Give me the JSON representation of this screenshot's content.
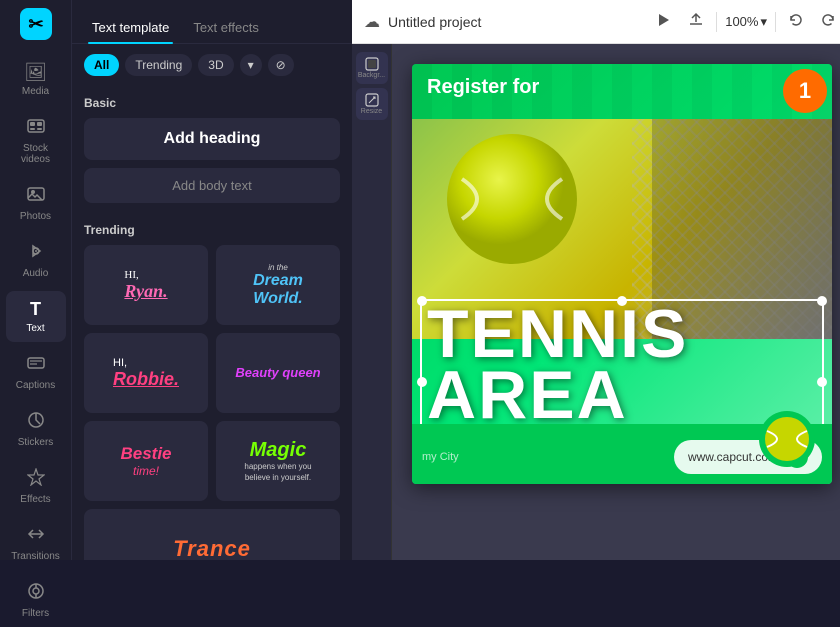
{
  "sidebar": {
    "logo": "✂",
    "items": [
      {
        "id": "media",
        "icon": "🖼",
        "label": "Media"
      },
      {
        "id": "stock-videos",
        "icon": "⊞",
        "label": "Stock videos"
      },
      {
        "id": "photos",
        "icon": "📷",
        "label": "Photos"
      },
      {
        "id": "audio",
        "icon": "♪",
        "label": "Audio"
      },
      {
        "id": "text",
        "icon": "T",
        "label": "Text",
        "active": true
      },
      {
        "id": "captions",
        "icon": "☰",
        "label": "Captions"
      },
      {
        "id": "stickers",
        "icon": "⊙",
        "label": "Stickers"
      },
      {
        "id": "effects",
        "icon": "✦",
        "label": "Effects"
      },
      {
        "id": "transitions",
        "icon": "⇄",
        "label": "Transitions"
      },
      {
        "id": "filters",
        "icon": "⊗",
        "label": "Filters"
      }
    ]
  },
  "panel": {
    "tab_template": "Text template",
    "tab_effects": "Text effects",
    "filters": {
      "all": "All",
      "trending": "Trending",
      "three_d": "3D",
      "dropdown": "▾",
      "filter_icon": "⊘"
    },
    "basic": {
      "title": "Basic",
      "add_heading": "Add heading",
      "add_body": "Add body text"
    },
    "trending": {
      "title": "Trending",
      "cards": [
        {
          "id": "hi-ryan",
          "type": "hi-ryan",
          "hi": "HI,",
          "name": "Ryan."
        },
        {
          "id": "dream-world",
          "type": "dream",
          "line1": "in the",
          "line2": "Dream",
          "line3": "World."
        },
        {
          "id": "hi-robbie",
          "type": "hi-robbie",
          "hi": "HI,",
          "name": "Robbie."
        },
        {
          "id": "beauty-queen",
          "type": "beauty",
          "text": "Beauty queen"
        },
        {
          "id": "bestie-time",
          "type": "bestie",
          "main": "Bestie",
          "sub": "time!"
        },
        {
          "id": "magic",
          "type": "magic",
          "main": "Magic",
          "sub": "happens when you\nbelieve in yourself."
        },
        {
          "id": "trance",
          "type": "trance",
          "text": "Trance"
        }
      ]
    }
  },
  "topbar": {
    "save_icon": "☁",
    "project_name": "Untitled project",
    "play_icon": "▶",
    "export_icon": "⬆",
    "zoom": "100%",
    "zoom_chevron": "▾",
    "undo_icon": "↩",
    "redo_icon": "↪"
  },
  "side_tools": [
    {
      "id": "background",
      "icon": "▭",
      "label": "Backgr..."
    },
    {
      "id": "resize",
      "icon": "⊡",
      "label": "Resize"
    }
  ],
  "canvas": {
    "register_text": "Register for",
    "tennis_title": "TENNIS\nAREA",
    "url": "www.capcut.com",
    "city": "my City"
  }
}
